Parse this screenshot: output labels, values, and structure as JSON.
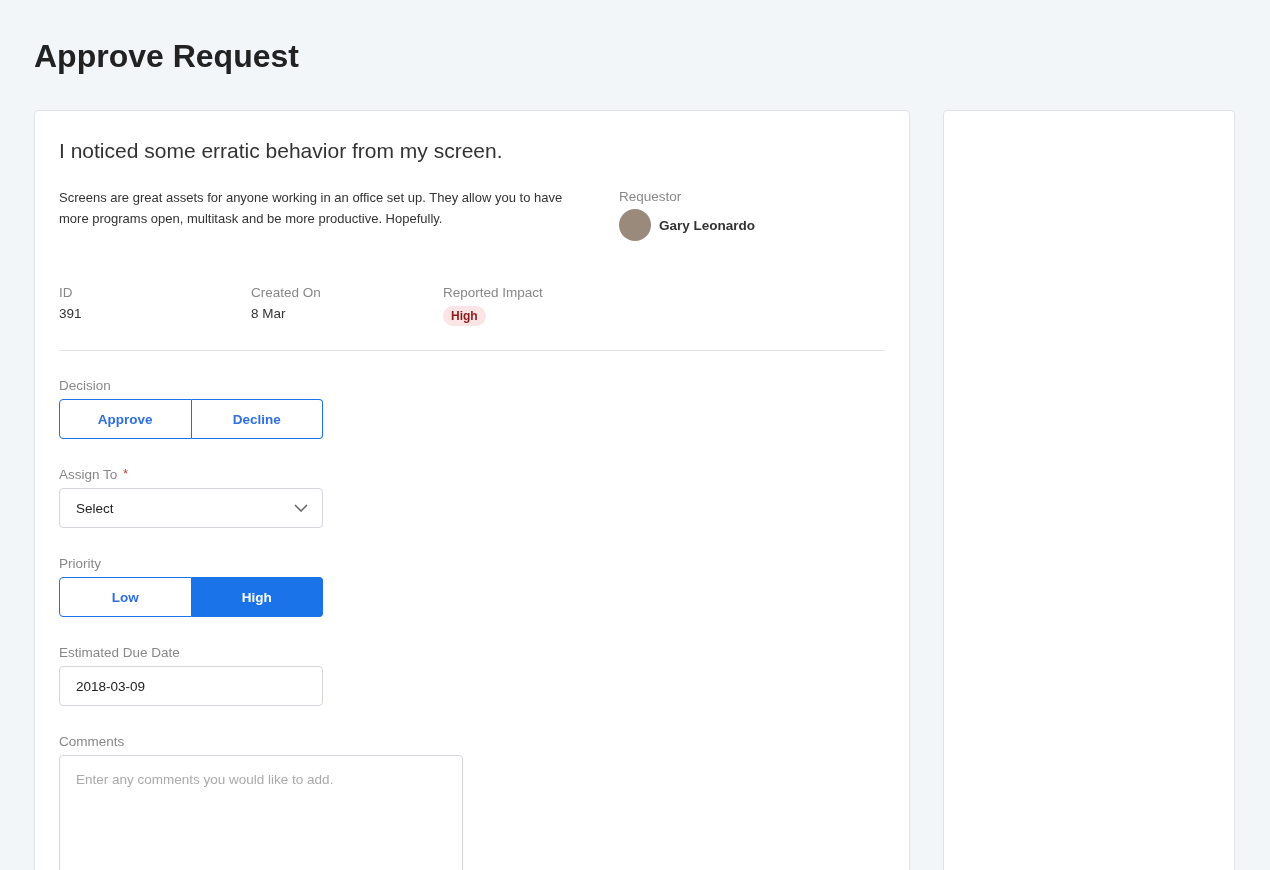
{
  "page_title": "Approve Request",
  "request": {
    "title": "I noticed some erratic behavior from my screen.",
    "description": "Screens are great assets for anyone working in an office set up. They allow you to have more programs open, multitask and be more productive. Hopefully.",
    "requestor_label": "Requestor",
    "requestor_name": "Gary Leonardo",
    "meta": [
      {
        "label": "ID",
        "value": "391",
        "kind": "text"
      },
      {
        "label": "Created On",
        "value": "8 Mar",
        "kind": "text"
      },
      {
        "label": "Reported Impact",
        "value": "High",
        "kind": "badge"
      }
    ]
  },
  "form": {
    "decision": {
      "label": "Decision",
      "options": [
        {
          "label": "Approve",
          "selected": false
        },
        {
          "label": "Decline",
          "selected": false
        }
      ]
    },
    "assign_to": {
      "label": "Assign To",
      "required_mark": "*",
      "value": "Select"
    },
    "priority": {
      "label": "Priority",
      "options": [
        {
          "label": "Low",
          "selected": false
        },
        {
          "label": "High",
          "selected": true
        }
      ]
    },
    "due_date": {
      "label": "Estimated Due Date",
      "value": "2018-03-09"
    },
    "comments": {
      "label": "Comments",
      "placeholder": "Enter any comments you would like to add."
    }
  }
}
